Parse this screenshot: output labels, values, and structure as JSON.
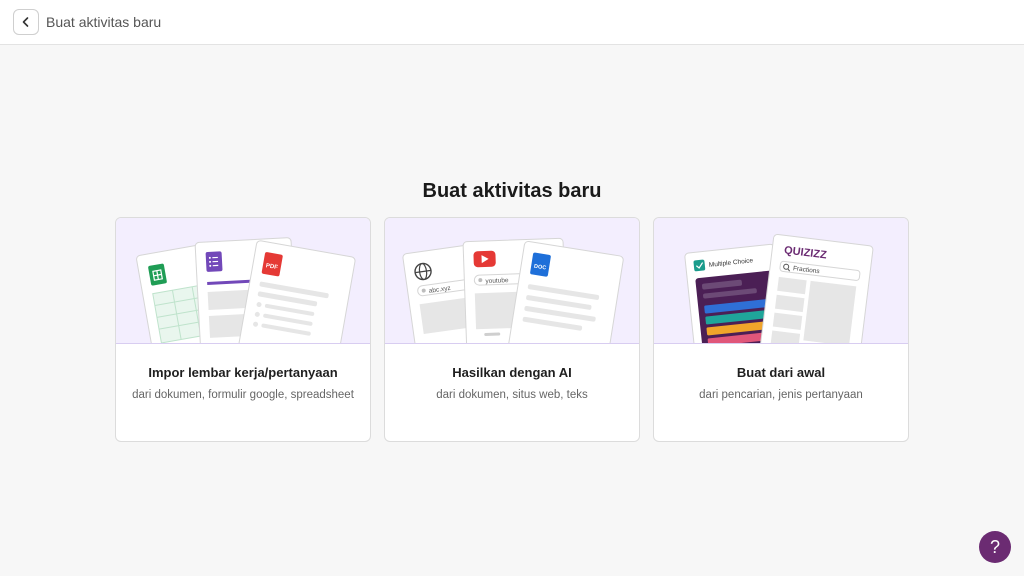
{
  "header": {
    "title": "Buat aktivitas baru"
  },
  "main": {
    "heading": "Buat aktivitas baru",
    "cards": [
      {
        "title": "Impor lembar kerja/pertanyaan",
        "subtitle": "dari dokumen, formulir google, spreadsheet",
        "illustration": {
          "badges": [
            "PDF"
          ]
        }
      },
      {
        "title": "Hasilkan dengan AI",
        "subtitle": "dari dokumen, situs web, teks",
        "illustration": {
          "urls": [
            "abc.xyz",
            "youtube"
          ],
          "badges": [
            "DOC"
          ]
        }
      },
      {
        "title": "Buat dari awal",
        "subtitle": "dari pencarian, jenis pertanyaan",
        "illustration": {
          "question_type": "Multiple Choice",
          "brand": "QUIZIZZ",
          "search_text": "Fractions"
        }
      }
    ]
  },
  "help": {
    "label": "?"
  },
  "colors": {
    "accent": "#6b2b72",
    "illustration_bg": "#f3eefe"
  }
}
